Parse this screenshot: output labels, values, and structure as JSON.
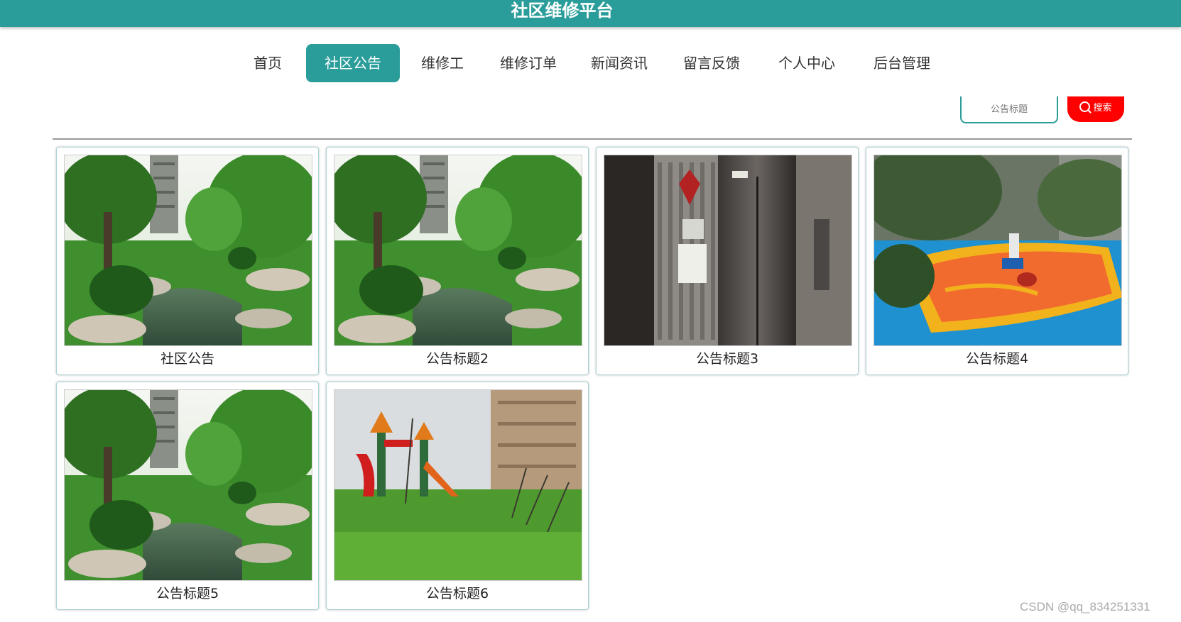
{
  "header": {
    "title": "社区维修平台"
  },
  "nav": [
    {
      "label": "首页",
      "active": false
    },
    {
      "label": "社区公告",
      "active": true
    },
    {
      "label": "维修工",
      "active": false
    },
    {
      "label": "维修订单",
      "active": false
    },
    {
      "label": "新闻资讯",
      "active": false
    },
    {
      "label": "留言反馈",
      "active": false
    },
    {
      "label": "个人中心",
      "active": false
    },
    {
      "label": "后台管理",
      "active": false
    }
  ],
  "search": {
    "placeholder": "公告标题",
    "button_label": "搜索",
    "button_icon": "search-icon"
  },
  "cards": [
    {
      "title": "社区公告",
      "image": "garden-pond"
    },
    {
      "title": "公告标题2",
      "image": "garden-pond"
    },
    {
      "title": "公告标题3",
      "image": "elevator-lobby"
    },
    {
      "title": "公告标题4",
      "image": "playground-track"
    },
    {
      "title": "公告标题5",
      "image": "garden-pond"
    },
    {
      "title": "公告标题6",
      "image": "playground-lawn"
    }
  ],
  "watermark": "CSDN @qq_834251331",
  "colors": {
    "primary": "#2a9d9a",
    "search_button": "#ff0000",
    "divider": "#999999"
  }
}
